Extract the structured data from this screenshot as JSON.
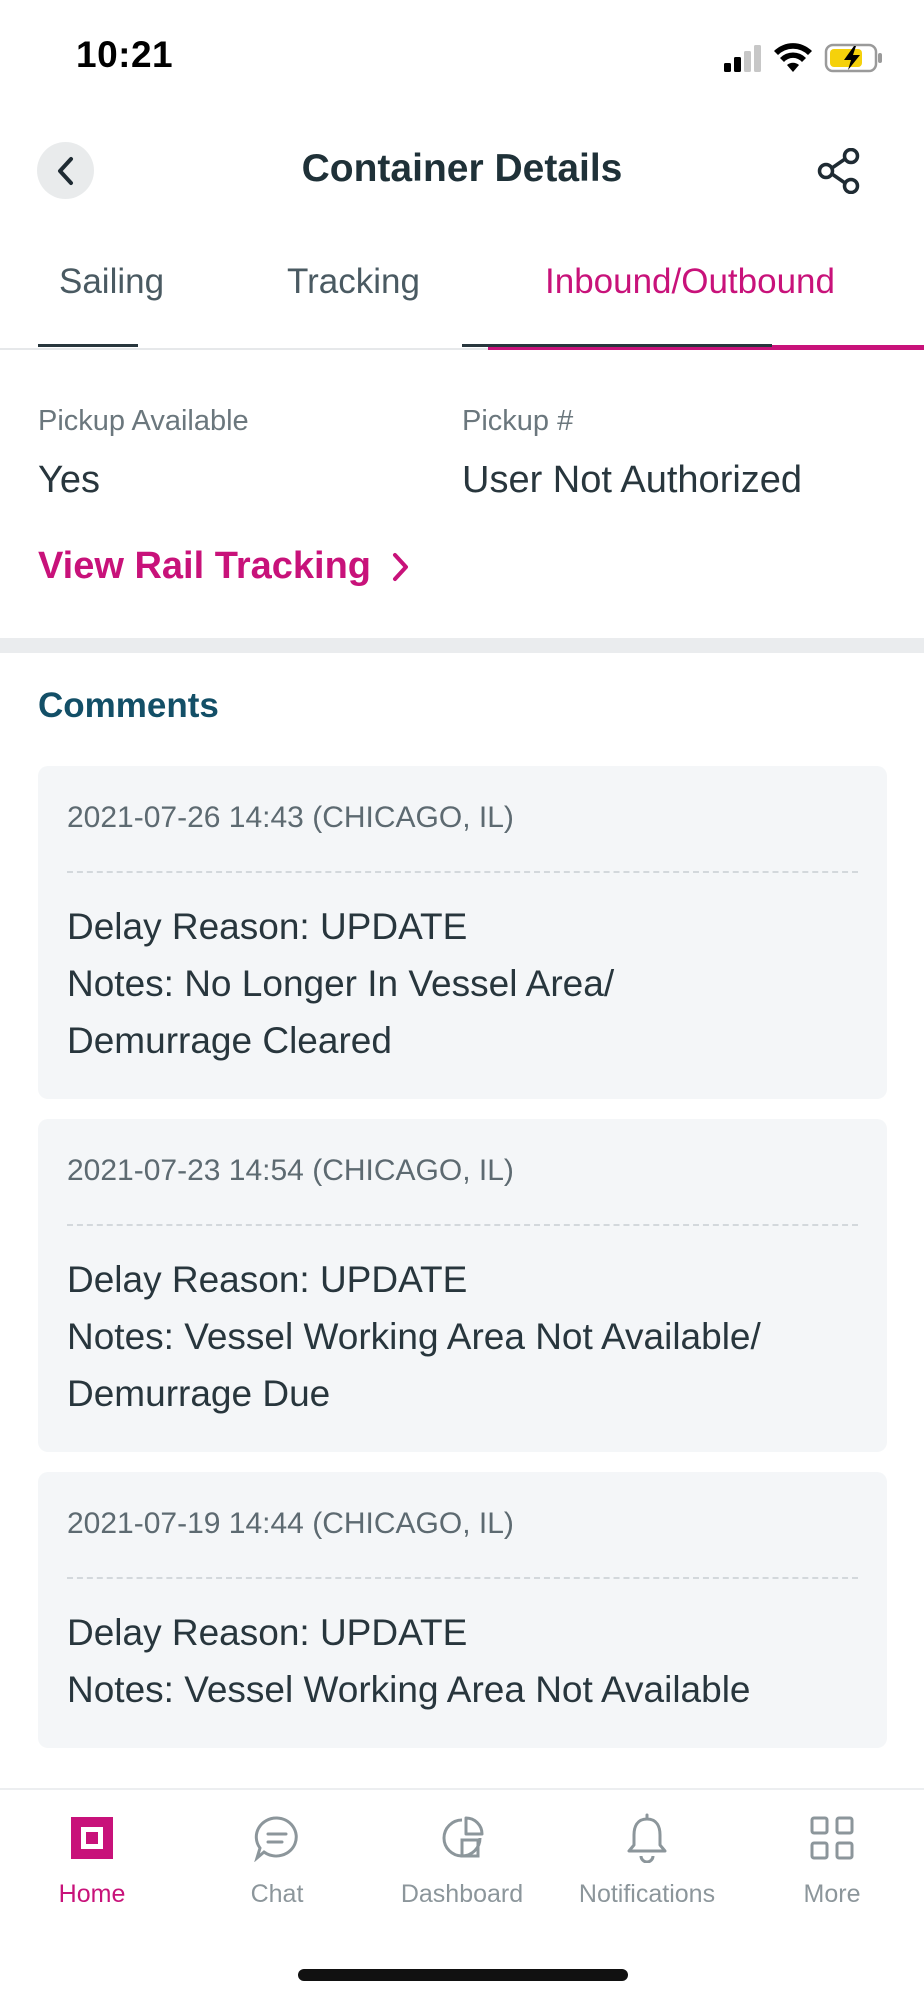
{
  "status_bar": {
    "time": "10:21"
  },
  "header": {
    "title": "Container Details"
  },
  "tabs": [
    {
      "label": "Sailing",
      "active": false
    },
    {
      "label": "Tracking",
      "active": false
    },
    {
      "label": "Inbound/Outbound",
      "active": true
    }
  ],
  "details": {
    "pickup_available_label": "Pickup Available",
    "pickup_available_value": "Yes",
    "pickup_number_label": "Pickup #",
    "pickup_number_value": "User Not Authorized",
    "rail_link": "View Rail Tracking"
  },
  "comments": {
    "heading": "Comments",
    "items": [
      {
        "meta": "2021-07-26 14:43 (CHICAGO, IL)",
        "line1": "Delay Reason:  UPDATE",
        "line2": "Notes:  No Longer In Vessel Area/",
        "line3": "Demurrage Cleared"
      },
      {
        "meta": "2021-07-23 14:54 (CHICAGO, IL)",
        "line1": "Delay Reason:  UPDATE",
        "line2": "Notes:  Vessel Working Area Not Available/",
        "line3": "Demurrage Due"
      },
      {
        "meta": "2021-07-19 14:44 (CHICAGO, IL)",
        "line1": "Delay Reason:  UPDATE",
        "line2": "Notes:  Vessel Working Area Not Available"
      }
    ]
  },
  "bottom_nav": [
    {
      "label": "Home",
      "icon": "home-icon",
      "active": true
    },
    {
      "label": "Chat",
      "icon": "chat-icon",
      "active": false
    },
    {
      "label": "Dashboard",
      "icon": "dashboard-icon",
      "active": false
    },
    {
      "label": "Notifications",
      "icon": "bell-icon",
      "active": false
    },
    {
      "label": "More",
      "icon": "grid-icon",
      "active": false
    }
  ],
  "colors": {
    "accent": "#c8127a",
    "heading": "#134f67",
    "card_bg": "#f4f6f8"
  }
}
